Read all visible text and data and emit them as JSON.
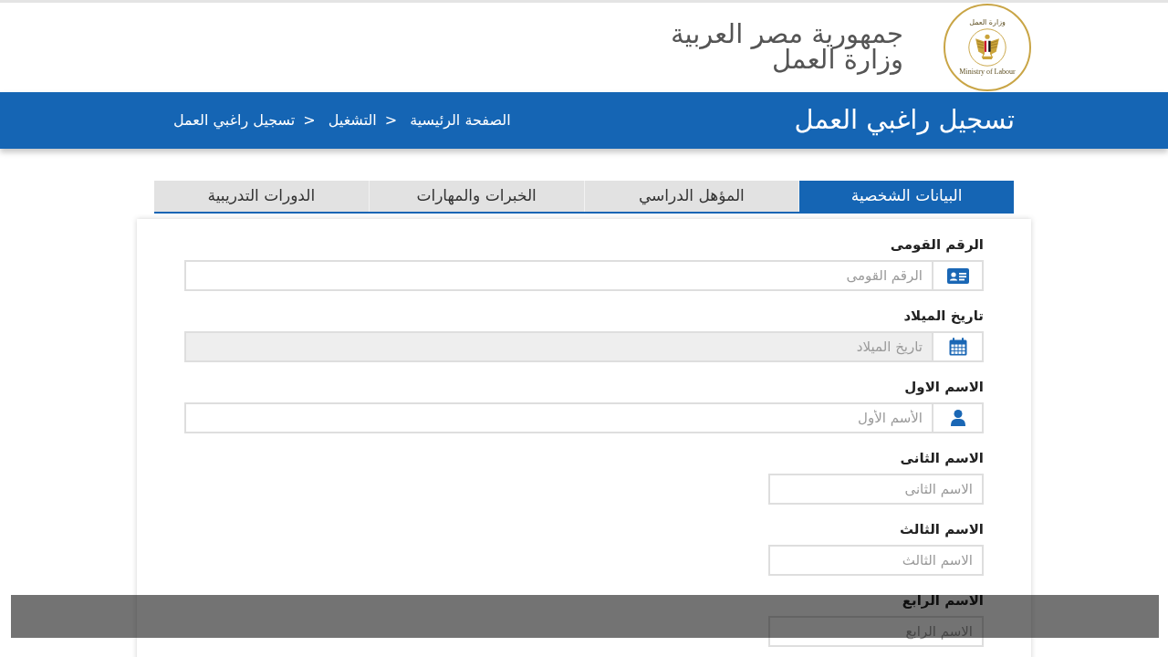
{
  "header": {
    "country": "جمهورية مصر العربية",
    "ministry": "وزارة العمل",
    "logo": {
      "arabic": "وزارة العمل",
      "english": "Ministry of Labour"
    }
  },
  "title_bar": {
    "title": "تسجيل راغبي العمل",
    "breadcrumb": [
      {
        "label": "الصفحة الرئيسية"
      },
      {
        "separator": ">",
        "label": "التشغيل"
      },
      {
        "separator": ">",
        "label": "تسجيل راغبي العمل"
      }
    ]
  },
  "tabs": [
    {
      "label": "البيانات الشخصية",
      "selected": true
    },
    {
      "label": "المؤهل الدراسي",
      "selected": false
    },
    {
      "label": "الخبرات والمهارات",
      "selected": false
    },
    {
      "label": "الدورات التدريبية",
      "selected": false
    }
  ],
  "fields": [
    {
      "kind": "id",
      "label": "الرقم القومى",
      "placeholder": "الرقم القومى",
      "disabled": false
    },
    {
      "kind": "date",
      "label": "تاريخ الميلاد",
      "placeholder": "تاريخ الميلاد",
      "disabled": true
    },
    {
      "kind": "name",
      "label": "الاسم الاول",
      "placeholder": "الأسم الأول",
      "disabled": false
    },
    {
      "kind": "plain",
      "label": "الاسم الثانى",
      "placeholder": "الاسم الثانى",
      "disabled": false
    },
    {
      "kind": "plain",
      "label": "الاسم الثالث",
      "placeholder": "الاسم الثالث",
      "disabled": false
    },
    {
      "kind": "plain",
      "label": "الاسم الرابع",
      "placeholder": "الاسم الرابع",
      "disabled": false
    }
  ]
}
